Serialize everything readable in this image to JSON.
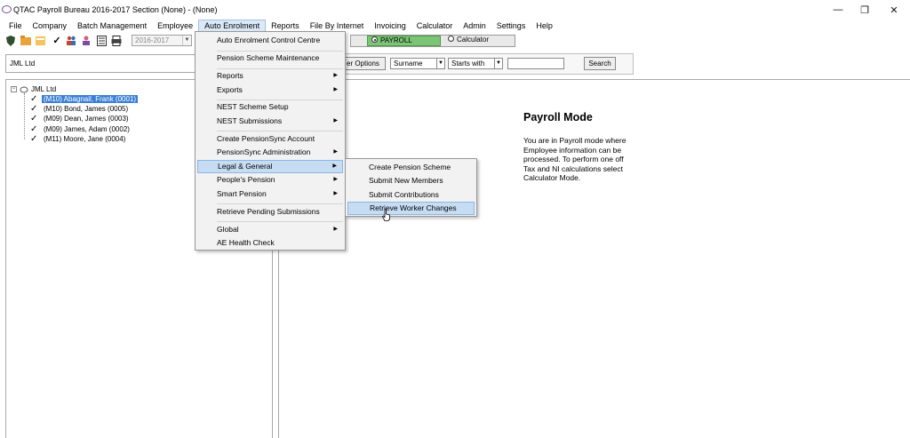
{
  "window": {
    "title": "QTAC Payroll Bureau 2016-2017  Section (None) - (None)",
    "controls": {
      "minimize": "—",
      "restore": "❐",
      "close": "✕"
    }
  },
  "menubar": [
    "File",
    "Company",
    "Batch Management",
    "Employee",
    "Auto Enrolment",
    "Reports",
    "File By Internet",
    "Invoicing",
    "Calculator",
    "Admin",
    "Settings",
    "Help"
  ],
  "toolbar": {
    "icons": [
      "shield-icon",
      "folder-icon",
      "open-folder-icon",
      "check-icon",
      "people-icon",
      "user-icon",
      "document-icon",
      "printer-icon"
    ],
    "year": "2016-2017",
    "payroll_label": "PAYROLL",
    "calculator_label": "Calculator"
  },
  "company": {
    "name": "JML Ltd"
  },
  "tree": {
    "root": "JML Ltd",
    "employees": [
      {
        "label": "(M10) Abagnail, Frank (0001)",
        "selected": true
      },
      {
        "label": "(M10) Bond, James (0005)",
        "selected": false
      },
      {
        "label": "(M09) Dean, James (0003)",
        "selected": false
      },
      {
        "label": "(M09) James, Adam (0002)",
        "selected": false
      },
      {
        "label": "(M11) Moore, Jane (0004)",
        "selected": false
      }
    ]
  },
  "search": {
    "options_label": "er Options",
    "field": "Surname",
    "match": "Starts with",
    "value": "",
    "button": "Search"
  },
  "mode": {
    "title": "Payroll Mode",
    "description": "You are in Payroll mode where Employee information can be processed. To perform one off Tax and NI calculations select Calculator Mode."
  },
  "auto_enrolment_menu": [
    {
      "label": "Auto Enrolment Control Centre",
      "submenu": false
    },
    {
      "label": "Pension Scheme Maintenance",
      "submenu": false
    },
    {
      "label": "Reports",
      "submenu": true
    },
    {
      "label": "Exports",
      "submenu": true
    },
    {
      "label": "NEST Scheme Setup",
      "submenu": false
    },
    {
      "label": "NEST Submissions",
      "submenu": true
    },
    {
      "label": "Create PensionSync Account",
      "submenu": false
    },
    {
      "label": "PensionSync Administration",
      "submenu": true
    },
    {
      "label": "Legal & General",
      "submenu": true,
      "highlighted": true
    },
    {
      "label": "People's Pension",
      "submenu": true
    },
    {
      "label": "Smart Pension",
      "submenu": true
    },
    {
      "label": "Retrieve Pending Submissions",
      "submenu": false
    },
    {
      "label": "Global",
      "submenu": true
    },
    {
      "label": "AE Health Check",
      "submenu": false
    }
  ],
  "legal_general_submenu": [
    {
      "label": "Create Pension Scheme"
    },
    {
      "label": "Submit New Members"
    },
    {
      "label": "Submit Contributions"
    },
    {
      "label": "Retrieve Worker Changes",
      "highlighted": true
    }
  ],
  "colors": {
    "payroll_green": "#7cc576",
    "selection_blue": "#3b80d4",
    "menu_highlight": "#c6dcf3"
  }
}
